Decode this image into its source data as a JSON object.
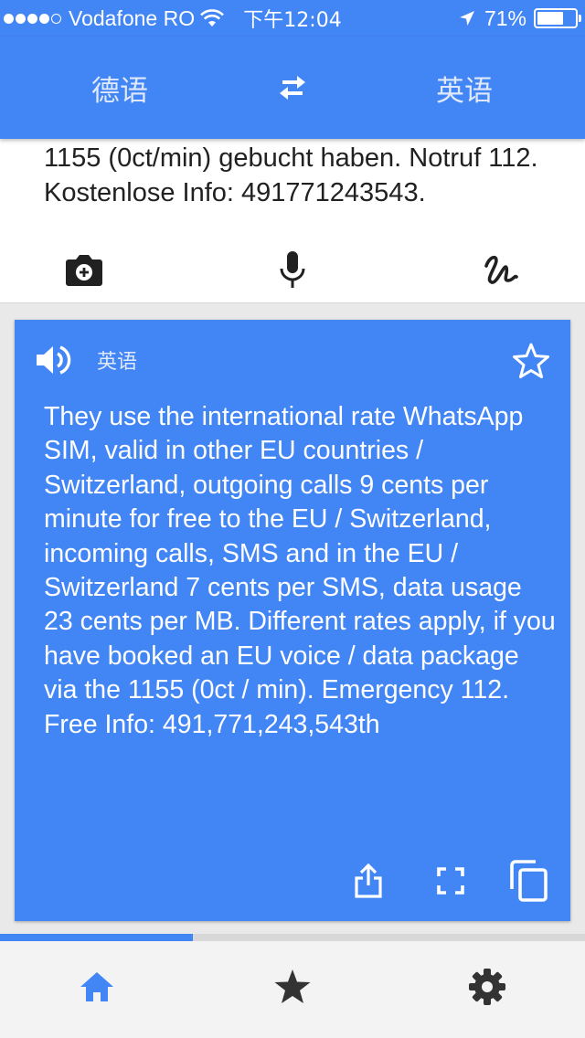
{
  "status_bar": {
    "carrier": "Vodafone RO",
    "time": "下午12:04",
    "battery_percent": "71%",
    "battery_level": 0.71,
    "signal_bars": 4,
    "signal_total": 5
  },
  "header": {
    "source_language": "德语",
    "target_language": "英语",
    "swap_icon": "swap-arrows-icon"
  },
  "input": {
    "text": "1155 (0ct/min) gebucht haben. Notruf 112. Kostenlose Info: 491771243543.",
    "tools": [
      "camera-icon",
      "microphone-icon",
      "handwriting-icon"
    ]
  },
  "result": {
    "language": "英语",
    "text": "They use the international rate WhatsApp SIM, valid in other EU countries / Switzerland, outgoing calls 9 cents per minute for free to the EU / Switzerland, incoming calls, SMS and in the EU / Switzerland 7 cents per SMS, data usage 23 cents per MB. Different rates apply, if you have booked an EU voice / data package via the 1155 (0ct / min). Emergency 112. Free Info: 491,771,243,543th",
    "actions": [
      "share-icon",
      "fullscreen-icon",
      "copy-icon"
    ]
  },
  "bottom_nav": {
    "progress": 0.33,
    "items": [
      "home-icon",
      "star-icon",
      "settings-icon"
    ],
    "active": "home-icon"
  },
  "colors": {
    "brand_blue": "#4285f4",
    "header_text": "#dfe9fb",
    "dark_icon": "#212121",
    "nav_icon": "#333333"
  }
}
